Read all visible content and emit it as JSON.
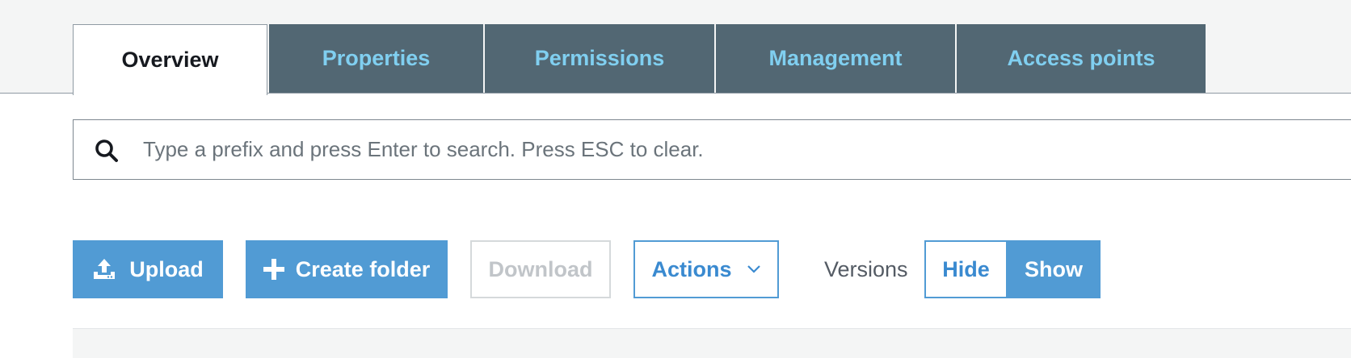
{
  "tabs": [
    {
      "label": "Overview",
      "active": true
    },
    {
      "label": "Properties",
      "active": false
    },
    {
      "label": "Permissions",
      "active": false
    },
    {
      "label": "Management",
      "active": false
    },
    {
      "label": "Access points",
      "active": false
    }
  ],
  "search": {
    "placeholder": "Type a prefix and press Enter to search. Press ESC to clear.",
    "value": "",
    "icon": "search-icon"
  },
  "toolbar": {
    "upload_label": "Upload",
    "upload_icon": "upload-icon",
    "create_folder_label": "Create folder",
    "create_folder_icon": "plus-icon",
    "download_label": "Download",
    "actions_label": "Actions",
    "actions_icon": "chevron-down-icon",
    "versions_label": "Versions",
    "versions_hide_label": "Hide",
    "versions_show_label": "Show",
    "versions_selected": "Show"
  },
  "colors": {
    "tab_inactive_bg": "#526773",
    "tab_inactive_text": "#80cff0",
    "primary": "#519bd4",
    "text_dark": "#16191f"
  }
}
